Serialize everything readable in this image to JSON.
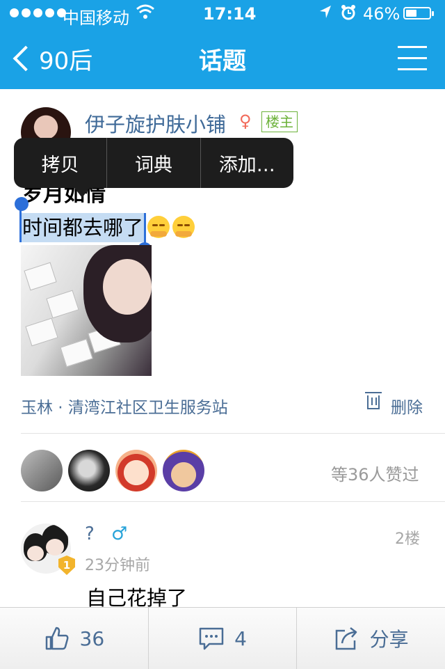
{
  "status": {
    "carrier": "中国移动",
    "time": "17:14",
    "battery": "46%",
    "battery_level": 0.46
  },
  "nav": {
    "back_label": "90后",
    "title": "话题"
  },
  "post": {
    "author": "伊子旋护肤小铺",
    "author_badge": "楼主",
    "title": "岁月如情",
    "body": "时间都去哪了",
    "location": "玉林 · 清湾江社区卫生服务站",
    "delete_label": "删除"
  },
  "context_menu": {
    "items": [
      "拷贝",
      "词典",
      "添加…"
    ]
  },
  "likes": {
    "count_text": "等36人赞过"
  },
  "comment": {
    "user": "?",
    "floor": "2楼",
    "time": "23分钟前",
    "text": "自己花掉了",
    "level": "1"
  },
  "bottom_bar": {
    "like_count": "36",
    "comment_count": "4",
    "share_label": "分享"
  },
  "colors": {
    "nav_bar": "#1aa2e6",
    "link_blue": "#4a6d95",
    "host_badge": "#6cb23a",
    "selection": "#c5dcf3"
  }
}
